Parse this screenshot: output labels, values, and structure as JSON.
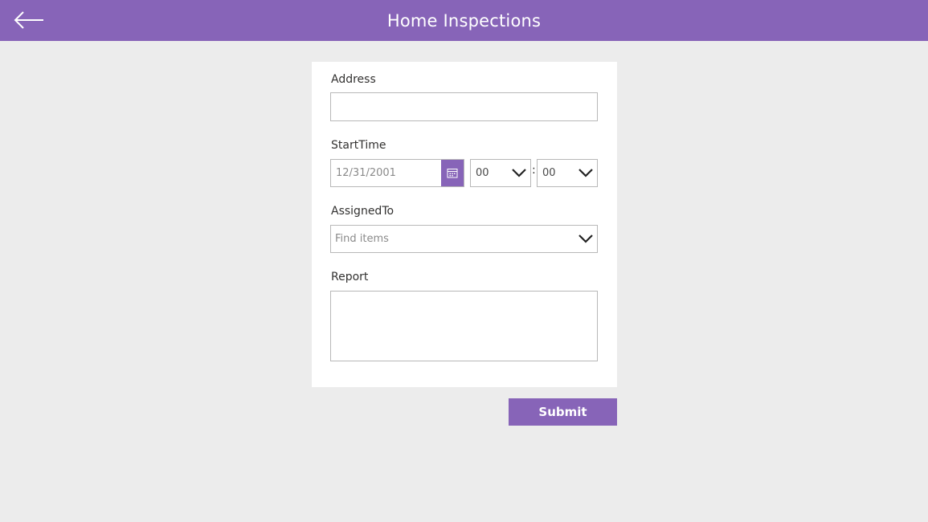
{
  "colors": {
    "accent": "#8764b8",
    "background": "#ececec",
    "card": "#ffffff"
  },
  "header": {
    "title": "Home Inspections",
    "back_icon": "arrow-left-icon"
  },
  "form": {
    "address": {
      "label": "Address",
      "value": ""
    },
    "start_time": {
      "label": "StartTime",
      "date_value": "12/31/2001",
      "calendar_icon": "calendar-icon",
      "hour_value": "00",
      "minute_value": "00",
      "separator": ":"
    },
    "assigned_to": {
      "label": "AssignedTo",
      "placeholder": "Find items"
    },
    "report": {
      "label": "Report",
      "value": ""
    }
  },
  "actions": {
    "submit_label": "Submit"
  }
}
